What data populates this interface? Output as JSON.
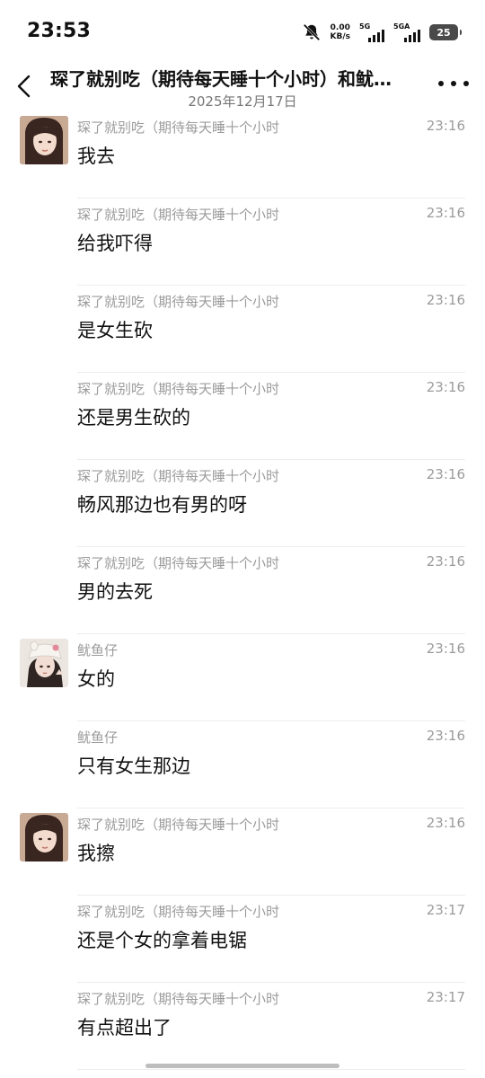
{
  "status_bar": {
    "time": "23:53",
    "net_speed_value": "0.00",
    "net_speed_unit": "KB/s",
    "signal1_label": "5G",
    "signal2_label": "5GA",
    "battery": "25"
  },
  "header": {
    "title": "琛了就别吃（期待每天睡十个小时）和鱿…",
    "date": "2025年12月17日"
  },
  "messages": [
    {
      "sender": "琛了就别吃（期待每天睡十个小时",
      "time": "23:16",
      "text": "我去",
      "avatar": "user1"
    },
    {
      "sender": "琛了就别吃（期待每天睡十个小时",
      "time": "23:16",
      "text": "给我吓得",
      "avatar": ""
    },
    {
      "sender": "琛了就别吃（期待每天睡十个小时",
      "time": "23:16",
      "text": "是女生砍",
      "avatar": ""
    },
    {
      "sender": "琛了就别吃（期待每天睡十个小时",
      "time": "23:16",
      "text": "还是男生砍的",
      "avatar": ""
    },
    {
      "sender": "琛了就别吃（期待每天睡十个小时",
      "time": "23:16",
      "text": "畅风那边也有男的呀",
      "avatar": ""
    },
    {
      "sender": "琛了就别吃（期待每天睡十个小时",
      "time": "23:16",
      "text": "男的去死",
      "avatar": ""
    },
    {
      "sender": "鱿鱼仔",
      "time": "23:16",
      "text": "女的",
      "avatar": "user2"
    },
    {
      "sender": "鱿鱼仔",
      "time": "23:16",
      "text": "只有女生那边",
      "avatar": ""
    },
    {
      "sender": "琛了就别吃（期待每天睡十个小时",
      "time": "23:16",
      "text": "我擦",
      "avatar": "user1"
    },
    {
      "sender": "琛了就别吃（期待每天睡十个小时",
      "time": "23:17",
      "text": "还是个女的拿着电锯",
      "avatar": ""
    },
    {
      "sender": "琛了就别吃（期待每天睡十个小时",
      "time": "23:17",
      "text": "有点超出了",
      "avatar": ""
    }
  ],
  "icons": {
    "back": "chevron-left-icon",
    "more": "more-dots-icon",
    "mute": "bell-off-icon"
  }
}
